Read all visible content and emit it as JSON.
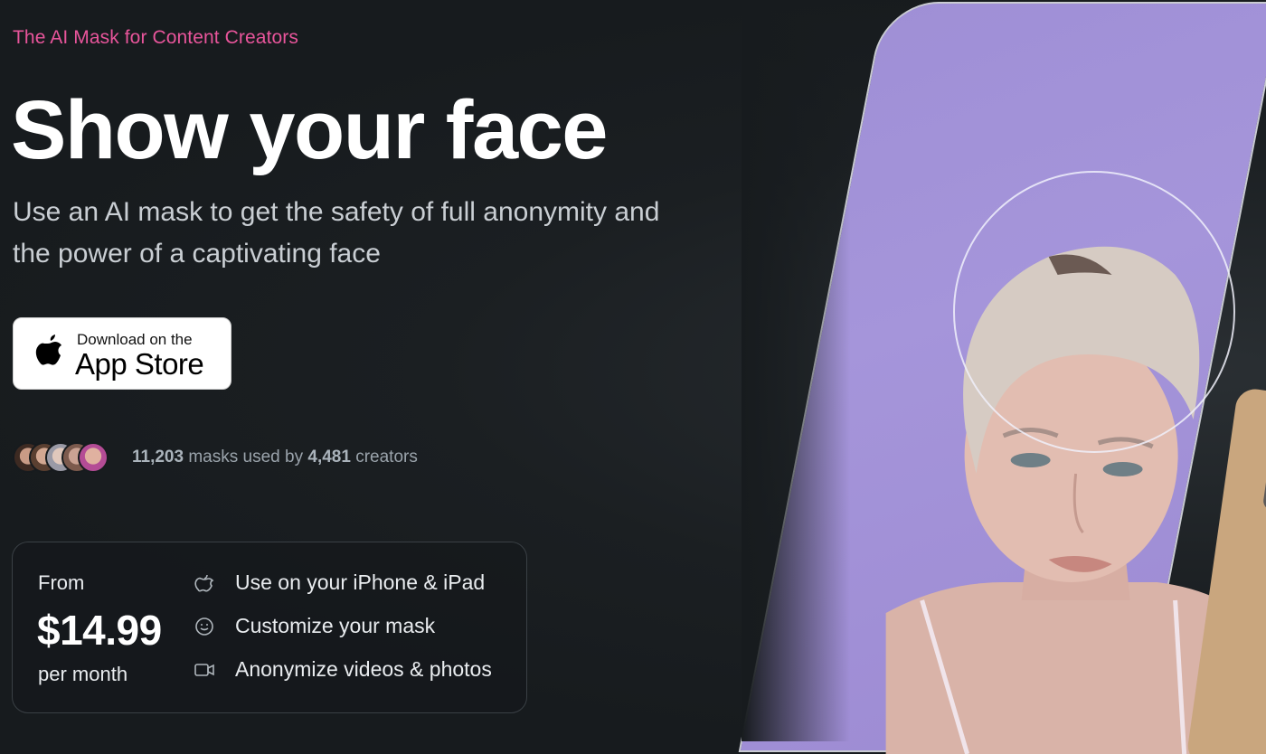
{
  "hero": {
    "eyebrow": "The AI Mask for Content Creators",
    "headline": "Show your face",
    "subhead": "Use an AI mask to get the safety of full anonymity and the power of a captivating face"
  },
  "app_store_button": {
    "small_label": "Download on the",
    "large_label": "App Store",
    "icon": "apple-logo-icon"
  },
  "social_proof": {
    "masks_count": "11,203",
    "masks_text": "masks used by",
    "creators_count": "4,481",
    "creators_text": "creators",
    "avatar_count": 5
  },
  "pricing": {
    "from_label": "From",
    "price": "$14.99",
    "period": "per month",
    "features": [
      {
        "icon": "apple-icon",
        "label": "Use on your iPhone & iPad"
      },
      {
        "icon": "face-mask-icon",
        "label": "Customize your mask"
      },
      {
        "icon": "video-camera-icon",
        "label": "Anonymize videos & photos"
      }
    ]
  },
  "colors": {
    "background": "#171b1e",
    "accent_pink": "#e8559b",
    "photo_background": "#a595da"
  }
}
